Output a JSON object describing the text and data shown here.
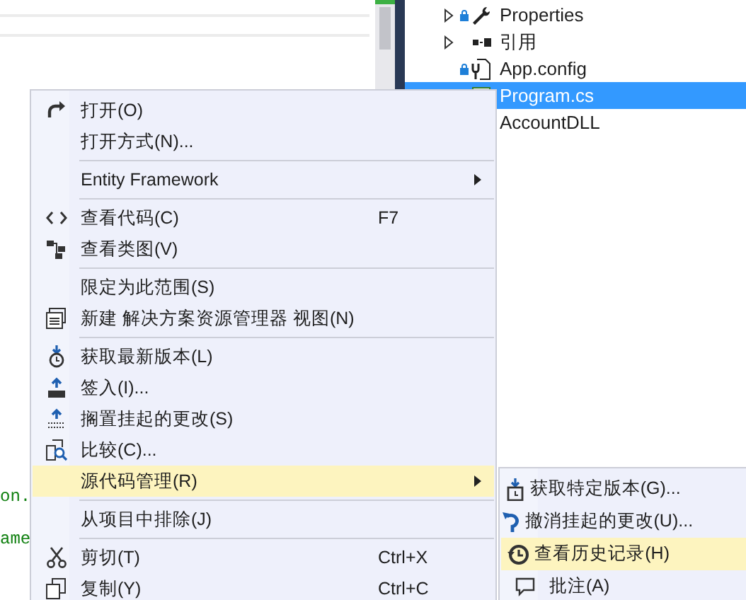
{
  "editor": {
    "code_lines": [
      "on.",
      "ame"
    ]
  },
  "explorer": {
    "items": [
      {
        "label": "Properties",
        "kind": "folder",
        "expanded": false,
        "selected": false
      },
      {
        "label": "引用",
        "kind": "references",
        "expanded": false,
        "selected": false
      },
      {
        "label": "App.config",
        "kind": "config",
        "selected": false
      },
      {
        "label": "Program.cs",
        "kind": "file",
        "selected": true
      },
      {
        "label": "AccountDLL",
        "kind": "project",
        "selected": false
      }
    ]
  },
  "context_menu": {
    "items": [
      {
        "kind": "item",
        "label": "打开(O)",
        "selected": false
      },
      {
        "kind": "item",
        "label": "打开方式(N)...",
        "selected": false
      },
      {
        "kind": "separator"
      },
      {
        "kind": "item",
        "label": "Entity Framework",
        "submenu": true,
        "selected": false
      },
      {
        "kind": "separator"
      },
      {
        "kind": "item",
        "label": "查看代码(C)",
        "shortcut": "F7",
        "selected": false
      },
      {
        "kind": "item",
        "label": "查看类图(V)",
        "selected": false
      },
      {
        "kind": "separator"
      },
      {
        "kind": "item",
        "label": "限定为此范围(S)",
        "selected": false
      },
      {
        "kind": "item",
        "label": "新建 解决方案资源管理器 视图(N)",
        "selected": false
      },
      {
        "kind": "separator"
      },
      {
        "kind": "item",
        "label": "获取最新版本(L)",
        "selected": false
      },
      {
        "kind": "item",
        "label": "签入(I)...",
        "selected": false
      },
      {
        "kind": "item",
        "label": "搁置挂起的更改(S)",
        "selected": false
      },
      {
        "kind": "item",
        "label": "比较(C)...",
        "selected": false
      },
      {
        "kind": "item",
        "label": "源代码管理(R)",
        "submenu": true,
        "selected": true
      },
      {
        "kind": "separator"
      },
      {
        "kind": "item",
        "label": "从项目中排除(J)",
        "selected": false
      },
      {
        "kind": "separator"
      },
      {
        "kind": "item",
        "label": "剪切(T)",
        "shortcut": "Ctrl+X",
        "selected": false
      },
      {
        "kind": "item",
        "label": "复制(Y)",
        "shortcut": "Ctrl+C",
        "selected": false
      }
    ]
  },
  "submenu": {
    "items": [
      {
        "label": "获取特定版本(G)...",
        "selected": false
      },
      {
        "label": "撤消挂起的更改(U)...",
        "selected": false
      },
      {
        "label": "查看历史记录(H)",
        "selected": true
      },
      {
        "label": "批注(A)",
        "selected": false
      }
    ]
  }
}
